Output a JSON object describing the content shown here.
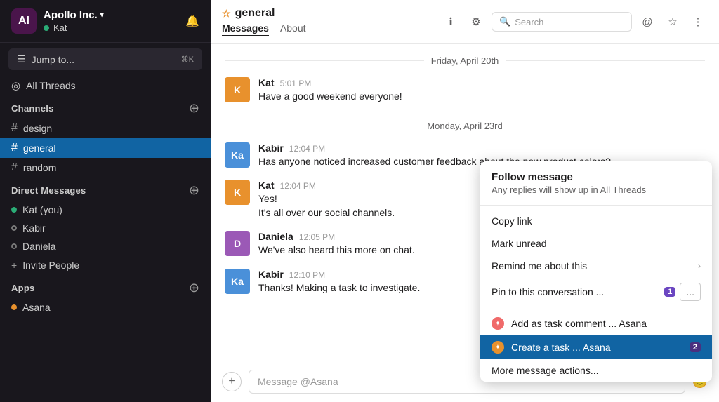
{
  "sidebar": {
    "workspace": "Apollo Inc.",
    "workspace_chevron": "▾",
    "user": "Kat",
    "bell_label": "🔔",
    "jump_to_label": "Jump to...",
    "jump_to_keyboard": "⌘K",
    "all_threads_label": "All Threads",
    "sections": [
      {
        "title": "Channels",
        "items": [
          {
            "name": "design",
            "active": false
          },
          {
            "name": "general",
            "active": true
          },
          {
            "name": "random",
            "active": false
          }
        ]
      },
      {
        "title": "Direct Messages",
        "items": [
          {
            "name": "Kat (you)",
            "online": true
          },
          {
            "name": "Kabir",
            "online": false
          },
          {
            "name": "Daniela",
            "online": false
          }
        ]
      }
    ],
    "invite_people_label": "Invite People",
    "apps_section": "Apps",
    "asana_app": "Asana"
  },
  "channel": {
    "name": "general",
    "tabs": [
      "Messages",
      "About"
    ],
    "active_tab": "Messages"
  },
  "header": {
    "search_placeholder": "Search",
    "info_icon": "ℹ",
    "settings_icon": "⚙",
    "at_icon": "@",
    "star_icon": "☆",
    "more_icon": "⋮"
  },
  "messages": {
    "date1": "Friday, April 20th",
    "date2": "Monday, April 23rd",
    "items": [
      {
        "author": "Kat",
        "time": "5:01 PM",
        "text": "Have a good weekend everyone!",
        "avatar_color": "#e8912d",
        "avatar_initials": "K"
      },
      {
        "author": "Kabir",
        "time": "12:04 PM",
        "text": "Has anyone noticed increased customer feedback about the new product colors?",
        "avatar_color": "#4a90d9",
        "avatar_initials": "Ka"
      },
      {
        "author": "Kat",
        "time": "12:04 PM",
        "text": "Yes!",
        "text2": "It's all over our social channels.",
        "avatar_color": "#e8912d",
        "avatar_initials": "K"
      },
      {
        "author": "Daniela",
        "time": "12:05 PM",
        "text": "We've also heard this more on chat.",
        "avatar_color": "#9b59b6",
        "avatar_initials": "D"
      },
      {
        "author": "Kabir",
        "time": "12:10 PM",
        "text": "Thanks! Making a task to investigate.",
        "avatar_color": "#4a90d9",
        "avatar_initials": "Ka"
      }
    ]
  },
  "context_menu": {
    "follow_title": "Follow message",
    "follow_desc": "Any replies will show up in All Threads",
    "copy_link": "Copy link",
    "mark_unread": "Mark unread",
    "remind_me": "Remind me about this",
    "pin_conv": "Pin to this conversation ...",
    "badge1": "1",
    "three_dots": "...",
    "badge2": "2",
    "asana_comment": "Add as task comment ... Asana",
    "asana_create": "Create a task ... Asana",
    "more_actions": "More message actions..."
  },
  "message_input": {
    "placeholder": "Message @Asana",
    "plus_label": "+",
    "emoji_label": "🙂"
  }
}
